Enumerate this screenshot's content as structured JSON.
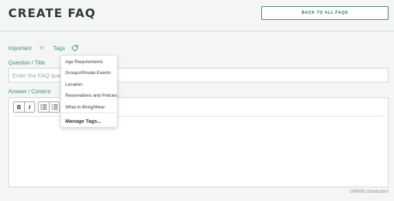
{
  "header": {
    "title": "CREATE FAQ",
    "back_button_label": "BACK TO ALL FAQS"
  },
  "meta": {
    "important_label": "Important",
    "tags_label": "Tags",
    "star_icon": "star-icon",
    "tag_icon": "tag-icon"
  },
  "question": {
    "label": "Question / Title",
    "placeholder": "Enter the FAQ question",
    "value": ""
  },
  "answer": {
    "label": "Answer / Content",
    "toolbar": {
      "bold": "B",
      "italic": "I"
    },
    "char_count": "0/4000 characters"
  },
  "tags_dropdown": {
    "items": [
      "Age Requirements",
      "Groups/Private Events",
      "Location",
      "Reservations and Policies",
      "What to Bring/Wear"
    ],
    "manage_label": "Manage Tags..."
  },
  "colors": {
    "accent": "#3f8a78",
    "title": "#2e3b37",
    "background": "#f4f6f5"
  }
}
